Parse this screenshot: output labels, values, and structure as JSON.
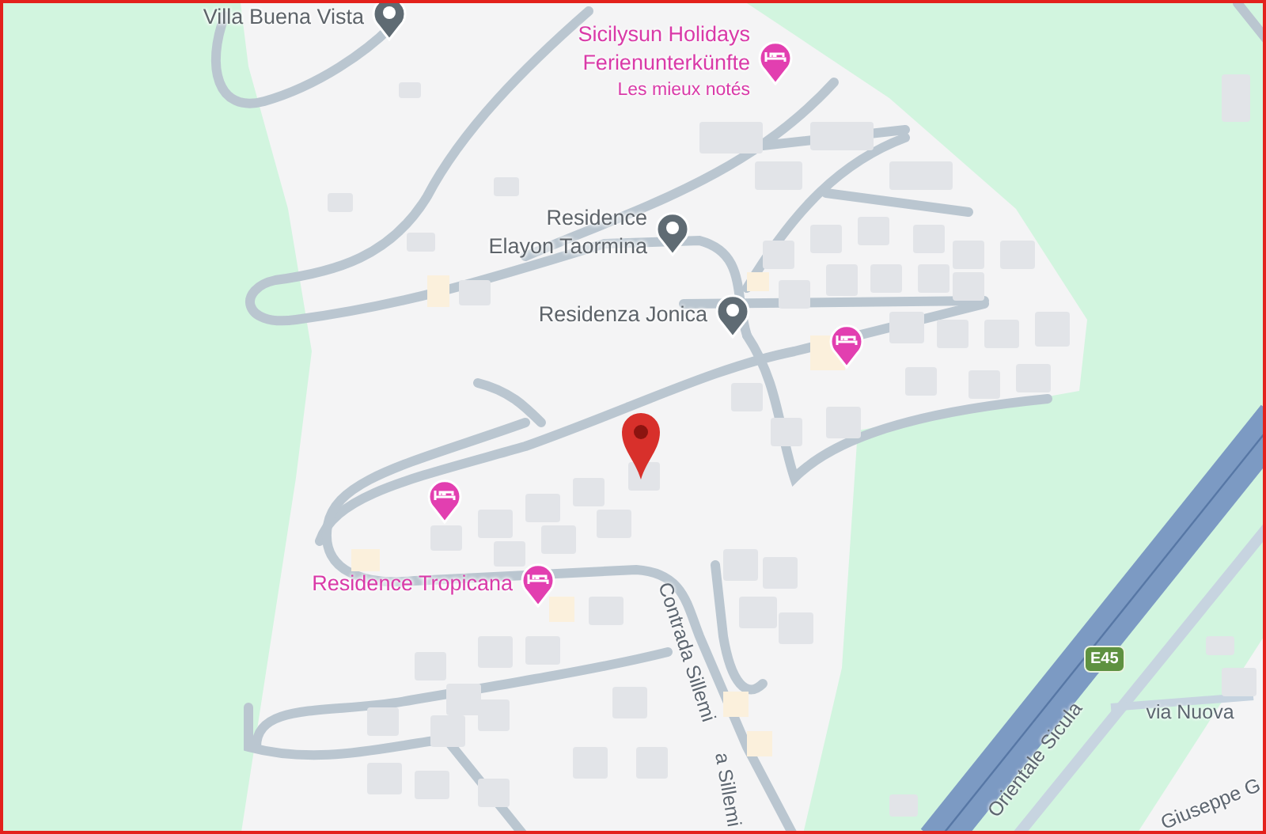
{
  "map": {
    "places": [
      {
        "kind": "landmark",
        "lines": [
          "Villa Buena Vista"
        ]
      },
      {
        "kind": "hotel",
        "lines": [
          "Sicilysun Holidays",
          "Ferienunterkünfte"
        ],
        "note": "Les mieux notés"
      },
      {
        "kind": "landmark",
        "lines": [
          "Residence",
          "Elayon Taormina"
        ]
      },
      {
        "kind": "landmark",
        "lines": [
          "Residenza Jonica"
        ]
      },
      {
        "kind": "hotel"
      },
      {
        "kind": "hotel"
      },
      {
        "kind": "hotel",
        "lines": [
          "Residence Tropicana"
        ]
      }
    ],
    "streets": [
      {
        "name": "Contrada Sillemi"
      },
      {
        "name": "a Sillemi"
      },
      {
        "name": "via Nuova"
      },
      {
        "name": "Orientale Sicula"
      },
      {
        "name": "Giuseppe G"
      }
    ],
    "route_shield": "E45"
  }
}
